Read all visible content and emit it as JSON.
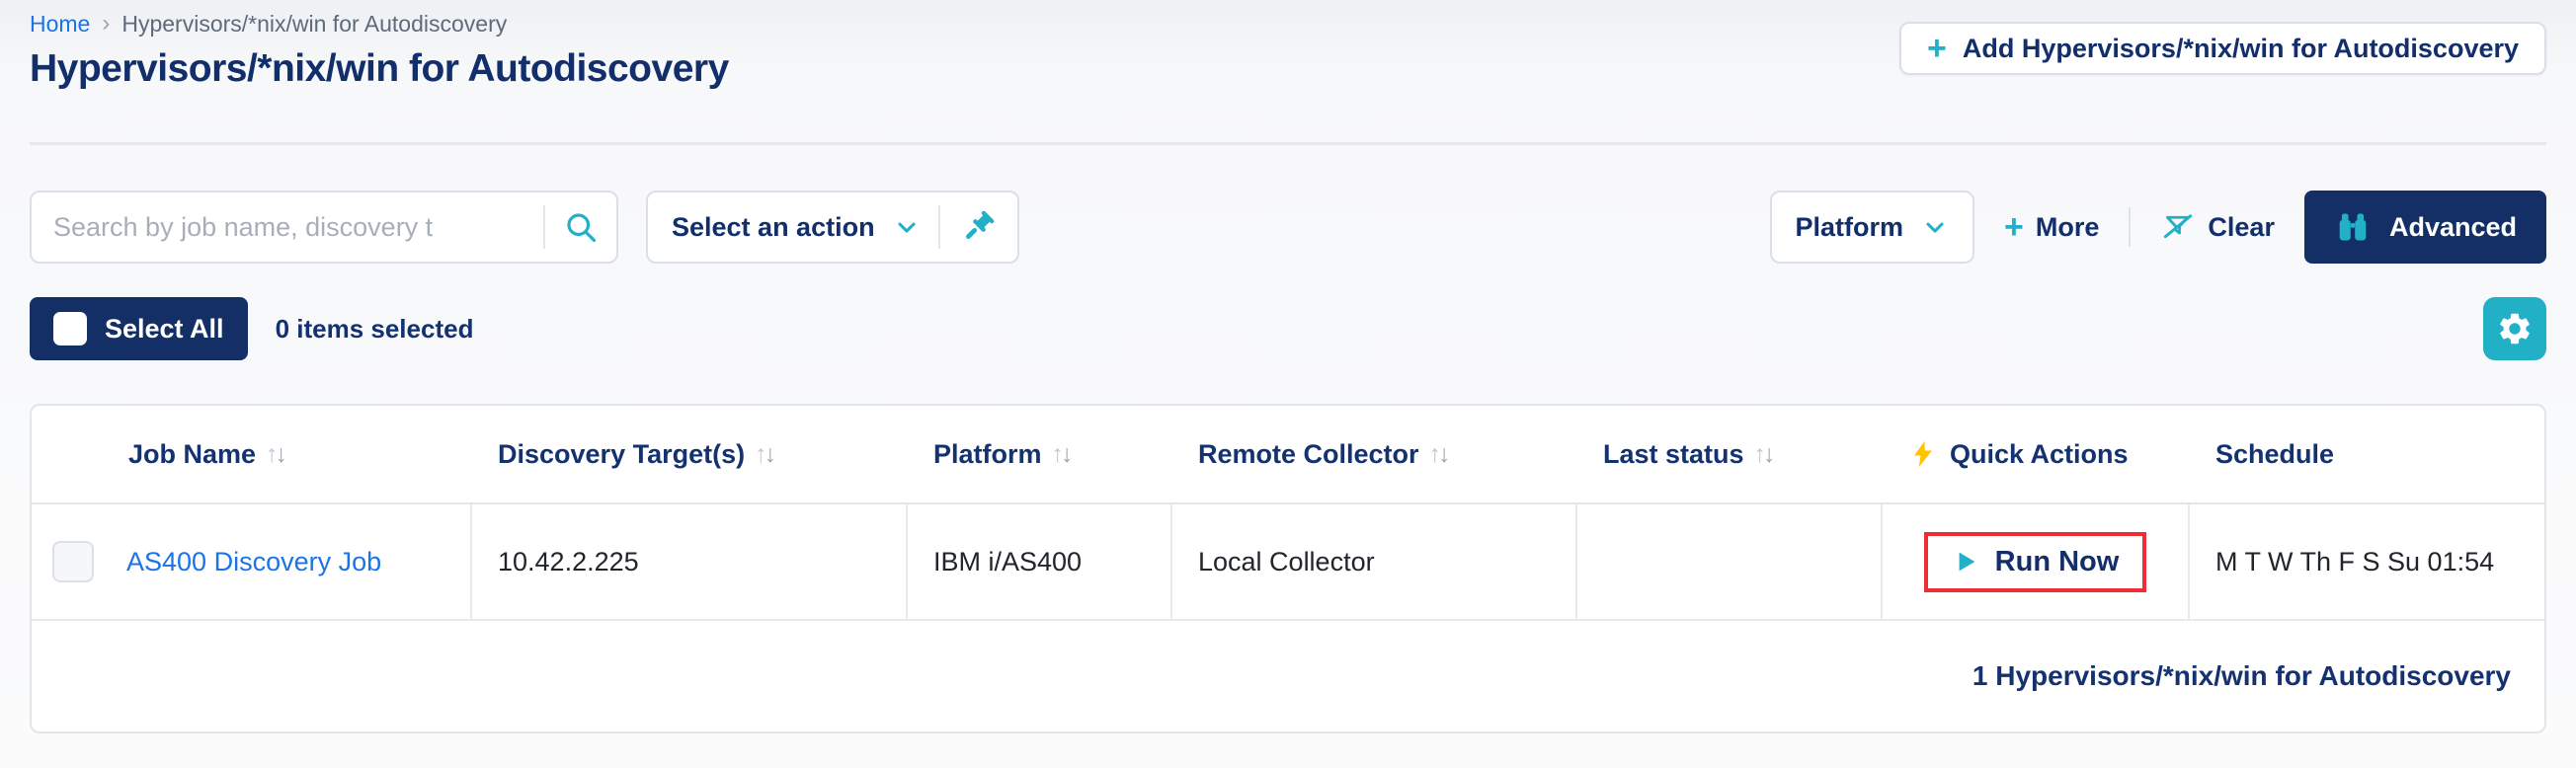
{
  "breadcrumb": {
    "home": "Home",
    "separator": "›",
    "current": "Hypervisors/*nix/win for Autodiscovery"
  },
  "page": {
    "title": "Hypervisors/*nix/win for Autodiscovery"
  },
  "header": {
    "add_button_label": "Add Hypervisors/*nix/win for Autodiscovery"
  },
  "filters": {
    "search_placeholder": "Search by job name, discovery t",
    "search_value": "",
    "action_select_label": "Select an action",
    "platform_label": "Platform",
    "more_label": "More",
    "clear_label": "Clear",
    "advanced_label": "Advanced"
  },
  "selection": {
    "select_all_label": "Select All",
    "items_selected": "0 items selected"
  },
  "icons": {
    "plus": "+",
    "sort_up": "↑",
    "sort_down": "↓"
  },
  "table": {
    "columns": [
      {
        "label": "Job Name",
        "sortable": true
      },
      {
        "label": "Discovery Target(s)",
        "sortable": true
      },
      {
        "label": "Platform",
        "sortable": true
      },
      {
        "label": "Remote Collector",
        "sortable": true
      },
      {
        "label": "Last status",
        "sortable": true
      },
      {
        "label": "Quick Actions",
        "sortable": false,
        "icon": "lightning-bolt"
      },
      {
        "label": "Schedule",
        "sortable": false
      }
    ],
    "rows": [
      {
        "job_name": "AS400 Discovery Job",
        "discovery_targets": "10.42.2.225",
        "platform": "IBM i/AS400",
        "remote_collector": "Local Collector",
        "last_status": "",
        "quick_action_label": "Run Now",
        "schedule": "M T W Th F S Su 01:54"
      }
    ],
    "footer_count": "1 Hypervisors/*nix/win for Autodiscovery"
  },
  "colors": {
    "navy": "#143170",
    "teal": "#22b0c7",
    "link_blue": "#1a73e8",
    "dark_button": "#142f66",
    "annotation_red": "#ee2e34",
    "bolt_yellow": "#ffc400"
  }
}
